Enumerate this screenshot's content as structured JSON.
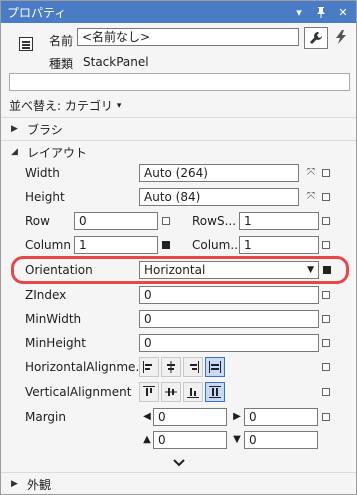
{
  "window": {
    "title": "プロパティ"
  },
  "object": {
    "name_label": "名前",
    "name_value": "<名前なし>",
    "type_label": "種類",
    "type_value": "StackPanel"
  },
  "search": {
    "placeholder": ""
  },
  "sort": {
    "label": "並べ替え: カテゴリ"
  },
  "categories": {
    "brush": "ブラシ",
    "layout": "レイアウト",
    "appearance": "外観"
  },
  "props": {
    "width": {
      "label": "Width",
      "value": "Auto (264)"
    },
    "height": {
      "label": "Height",
      "value": "Auto (84)"
    },
    "row": {
      "label": "Row",
      "value": "0"
    },
    "rowspan": {
      "label": "RowS...",
      "value": "1"
    },
    "column": {
      "label": "Column",
      "value": "1"
    },
    "columnspan": {
      "label": "Colum...",
      "value": "1"
    },
    "orientation": {
      "label": "Orientation",
      "value": "Horizontal"
    },
    "zindex": {
      "label": "ZIndex",
      "value": "0"
    },
    "minwidth": {
      "label": "MinWidth",
      "value": "0"
    },
    "minheight": {
      "label": "MinHeight",
      "value": "0"
    },
    "halign": {
      "label": "HorizontalAlignme..."
    },
    "valign": {
      "label": "VerticalAlignment"
    },
    "margin": {
      "label": "Margin",
      "left": "0",
      "right": "0",
      "top": "0",
      "bottom": "0"
    }
  },
  "colors": {
    "titlebar": "#4a7bc5",
    "highlight": "#e8474a",
    "selected_btn": "#c9daf6"
  }
}
